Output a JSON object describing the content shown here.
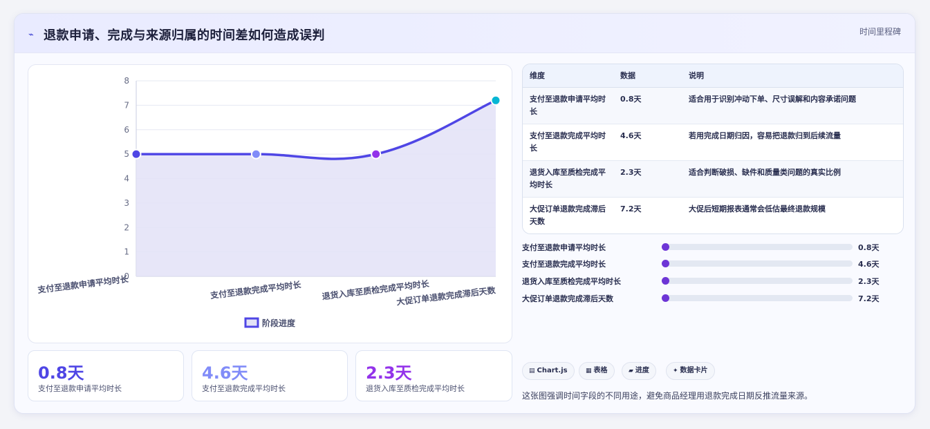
{
  "header": {
    "icon": "sparkline-icon",
    "icon_glyph": "⌁",
    "title": "退款申请、完成与来源归属的时间差如何造成误判",
    "link": "时间里程碑"
  },
  "chart_data": {
    "type": "line",
    "categories": [
      "支付至退款申请平均时长",
      "支付至退款完成平均时长",
      "退货入库至质检完成平均时长",
      "大促订单退款完成滞后天数"
    ],
    "series": [
      {
        "name": "阶段进度",
        "values": [
          5,
          5,
          5,
          7.2
        ]
      }
    ],
    "ylim": [
      0,
      8
    ],
    "yticks": [
      0,
      1,
      2,
      3,
      4,
      5,
      6,
      7,
      8
    ],
    "point_colors": [
      "#4f46e5",
      "#818cf8",
      "#9333ea",
      "#06b6d4"
    ],
    "line_color": "#4f46e5",
    "fill_color": "#e3e2f7",
    "grid": true,
    "legend_position": "bottom"
  },
  "stats": [
    {
      "value": "0.8天",
      "label": "支付至退款申请平均时长",
      "color": "#4f46e5"
    },
    {
      "value": "4.6天",
      "label": "支付至退款完成平均时长",
      "color": "#818cf8"
    },
    {
      "value": "2.3天",
      "label": "退货入库至质检完成平均时长",
      "color": "#9333ea"
    }
  ],
  "table": {
    "headers": [
      "维度",
      "数据",
      "说明"
    ],
    "rows": [
      {
        "dimension": "支付至退款申请平均时长",
        "value": "0.8天",
        "note": "适合用于识别冲动下单、尺寸误解和内容承诺问题"
      },
      {
        "dimension": "支付至退款完成平均时长",
        "value": "4.6天",
        "note": "若用完成日期归因，容易把退款归到后续流量"
      },
      {
        "dimension": "退货入库至质检完成平均时长",
        "value": "2.3天",
        "note": "适合判断破损、缺件和质量类问题的真实比例"
      },
      {
        "dimension": "大促订单退款完成滞后天数",
        "value": "7.2天",
        "note": "大促后短期报表通常会低估最终退款规模"
      }
    ]
  },
  "progress": [
    {
      "label": "支付至退款申请平均时长",
      "value": "0.8天"
    },
    {
      "label": "支付至退款完成平均时长",
      "value": "4.6天"
    },
    {
      "label": "退货入库至质检完成平均时长",
      "value": "2.3天"
    },
    {
      "label": "大促订单退款完成滞后天数",
      "value": "7.2天"
    }
  ],
  "tags": [
    {
      "icon": "chart-icon",
      "glyph": "▤",
      "label": "Chart.js"
    },
    {
      "icon": "table-icon",
      "glyph": "▦",
      "label": "表格"
    },
    {
      "icon": "progress-icon",
      "glyph": "▰",
      "label": "进度"
    },
    {
      "icon": "sparkle-icon",
      "glyph": "✦",
      "label": "数据卡片"
    }
  ],
  "footnote": "这张图强调时间字段的不同用途，避免商品经理用退款完成日期反推流量来源。"
}
